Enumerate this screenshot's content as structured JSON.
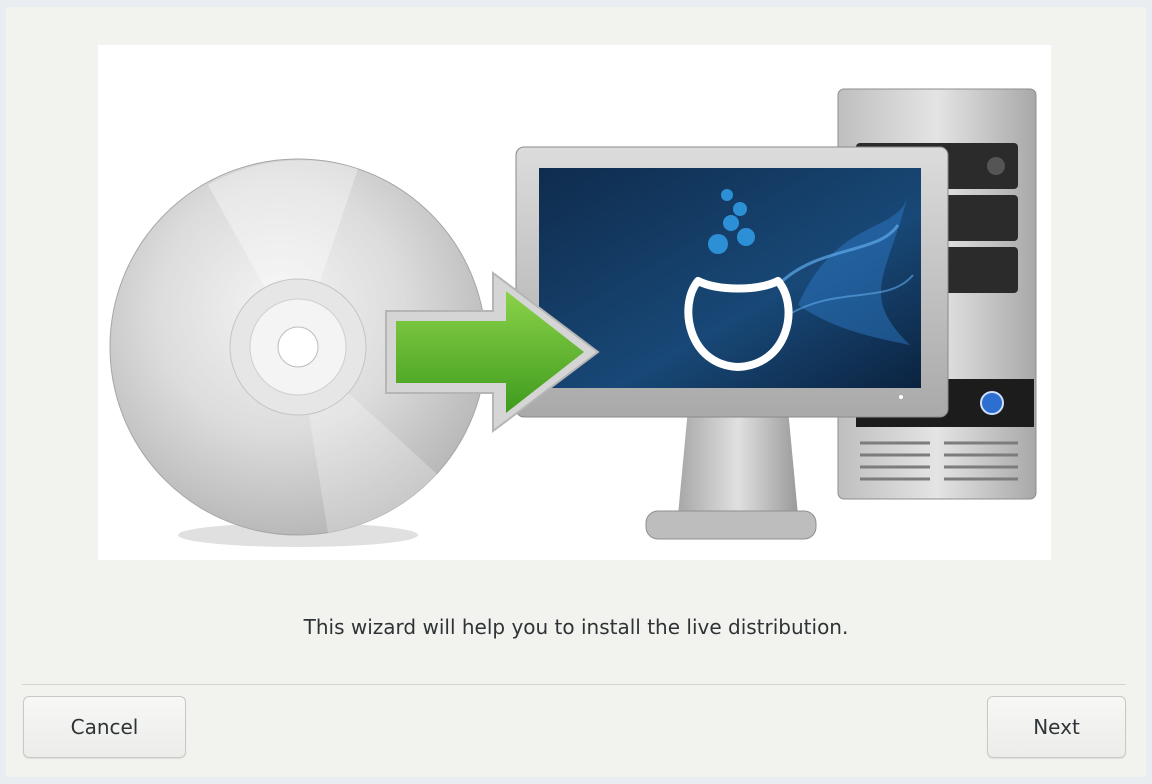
{
  "wizard": {
    "message": "This wizard will help you to install the live distribution.",
    "hero_image": "live-install-illustration"
  },
  "buttons": {
    "cancel_label": "Cancel",
    "next_label": "Next"
  },
  "colors": {
    "window_bg": "#f2f2ee",
    "arrow_green": "#5fb32b",
    "screen_blue": "#163d66",
    "logo_blue": "#2d8fd6"
  }
}
